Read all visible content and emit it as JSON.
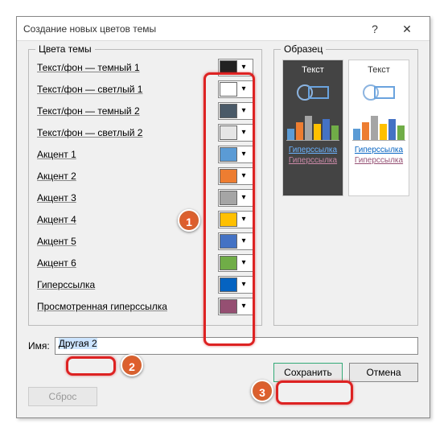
{
  "title": "Создание новых цветов темы",
  "fieldset_colors": "Цвета темы",
  "fieldset_sample": "Образец",
  "colors": [
    {
      "label": "Текст/фон — темный 1",
      "hex": "#222222"
    },
    {
      "label": "Текст/фон — светлый 1",
      "hex": "#ffffff"
    },
    {
      "label": "Текст/фон — темный 2",
      "hex": "#4a5a68"
    },
    {
      "label": "Текст/фон — светлый 2",
      "hex": "#e6e6e6"
    },
    {
      "label": "Акцент 1",
      "hex": "#5b9bd5"
    },
    {
      "label": "Акцент 2",
      "hex": "#ed7d31"
    },
    {
      "label": "Акцент 3",
      "hex": "#a5a5a5"
    },
    {
      "label": "Акцент 4",
      "hex": "#ffc000"
    },
    {
      "label": "Акцент 5",
      "hex": "#4472c4"
    },
    {
      "label": "Акцент 6",
      "hex": "#70ad47"
    },
    {
      "label": "Гиперссылка",
      "hex": "#0563c1"
    },
    {
      "label": "Просмотренная гиперссылка",
      "hex": "#954f72"
    }
  ],
  "sample": {
    "text_label": "Текст",
    "hyperlink": "Гиперссылка",
    "visited": "Гиперссылка"
  },
  "name_label": "Имя:",
  "name_value": "Другая 2",
  "buttons": {
    "reset": "Сброс",
    "save": "Сохранить",
    "cancel": "Отмена"
  },
  "annotations": {
    "b1": "1",
    "b2": "2",
    "b3": "3"
  }
}
